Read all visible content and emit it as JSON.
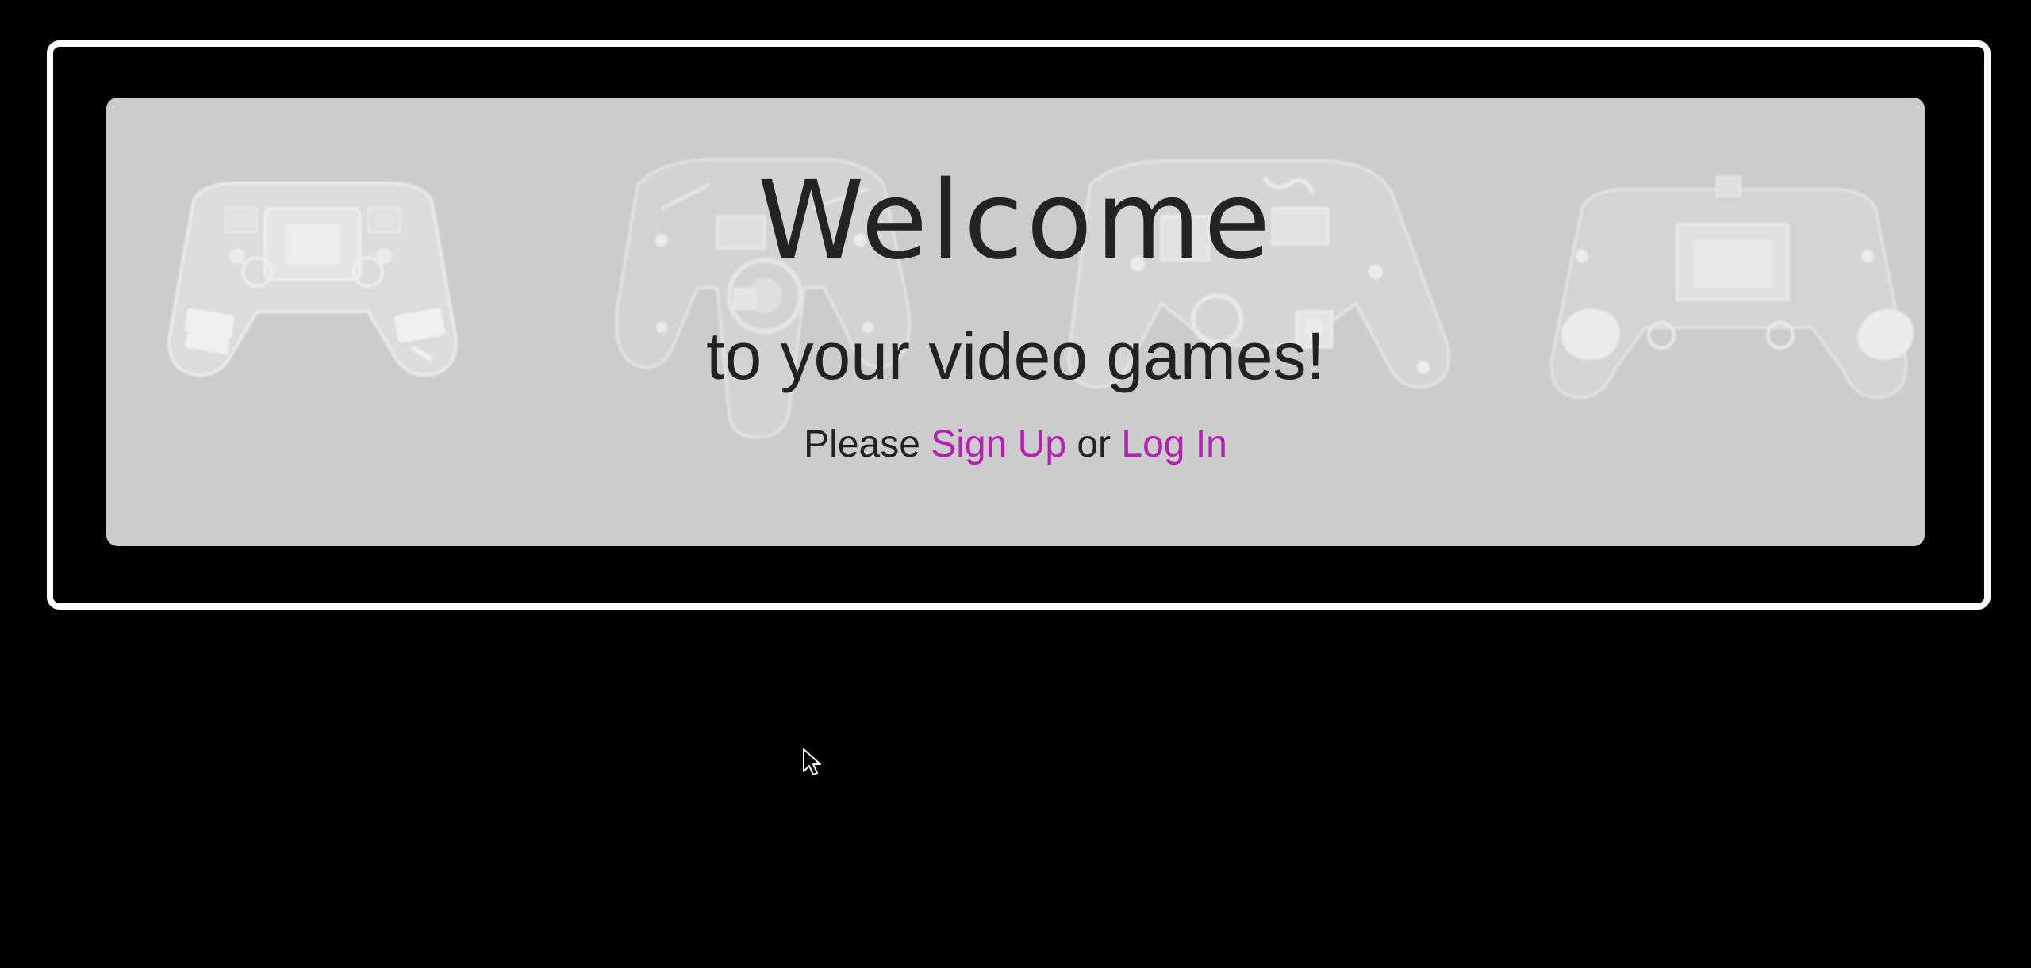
{
  "hero": {
    "title": "Welcome",
    "subtitle": "to your video games!",
    "prompt_prefix": "Please",
    "signup_label": "Sign Up",
    "prompt_middle": "or",
    "login_label": "Log In"
  },
  "colors": {
    "page_background": "#000000",
    "frame_border": "#ffffff",
    "hero_background": "#cccccc",
    "title_text": "#232323",
    "body_text": "#222222",
    "link": "#b41fb4"
  },
  "icons": {
    "background_art": [
      "controller-xray-icon",
      "controller-xray-icon",
      "controller-xray-icon",
      "controller-xray-icon"
    ],
    "pointer": "mouse-cursor-icon"
  }
}
